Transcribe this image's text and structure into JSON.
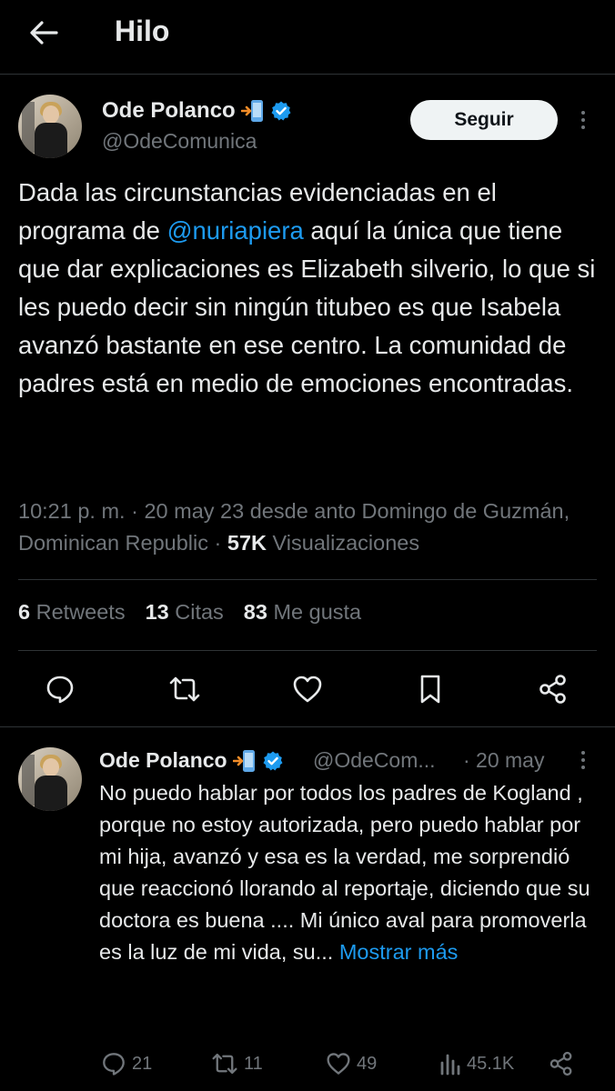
{
  "header": {
    "title": "Hilo",
    "back_icon": "arrow-left-icon"
  },
  "main_tweet": {
    "author_name": "Ode Polanco",
    "author_handle": "@OdeComunica",
    "follow_label": "Seguir",
    "text_before_mention": "Dada las circunstancias evidenciadas en el programa de ",
    "mention": "@nuriapiera",
    "text_after_mention": " aquí la única que tiene que dar explicaciones es Elizabeth silverio,  lo que si les puedo decir sin ningún titubeo es que Isabela avanzó bastante en ese centro. La comunidad de padres está en medio de emociones encontradas.",
    "time": "10:21 p. m.",
    "date": "20 may 23",
    "location": "desde anto Domingo de Guzmán, Dominican Republic",
    "views_count": "57K",
    "views_label": "Visualizaciones",
    "retweets_count": "6",
    "retweets_label": "Retweets",
    "quotes_count": "13",
    "quotes_label": "Citas",
    "likes_count": "83",
    "likes_label": "Me gusta"
  },
  "reply": {
    "author_name": "Ode Polanco",
    "author_handle": "@OdeCom...",
    "date": "· 20 may",
    "text": "No puedo hablar por todos los padres de Kogland , porque no estoy autorizada, pero puedo hablar por mi hija, avanzó y esa es la verdad, me sorprendió que reaccionó llorando al reportaje, diciendo que su doctora es buena .... Mi único aval para promoverla es la luz de mi vida, su... ",
    "show_more": "Mostrar más",
    "replies": "21",
    "retweets": "11",
    "likes": "49",
    "views": "45.1K"
  },
  "colors": {
    "background": "#000000",
    "accent": "#1d9bf0",
    "muted": "#71767b",
    "text": "#e7e9ea"
  }
}
